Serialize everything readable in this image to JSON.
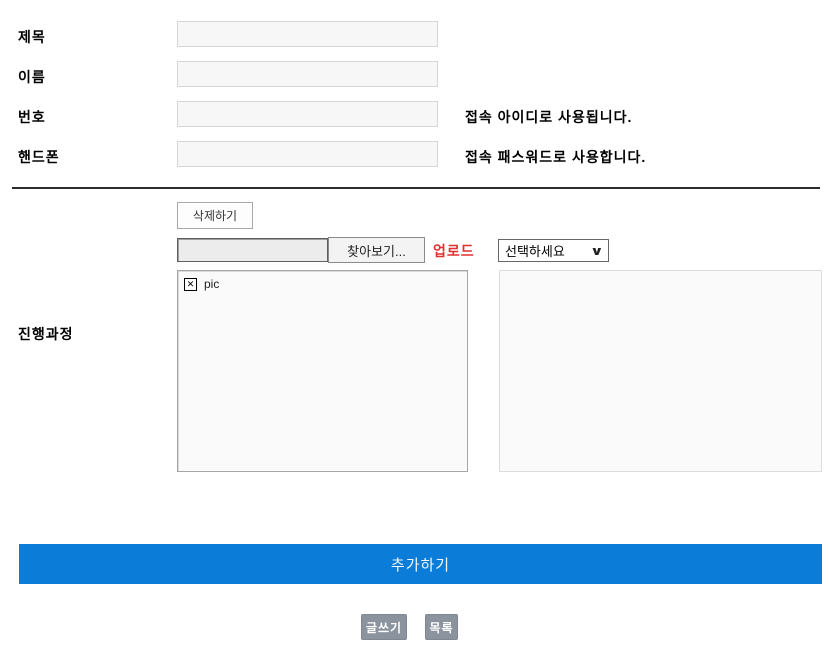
{
  "form": {
    "rows": [
      {
        "label": "제목",
        "note": ""
      },
      {
        "label": "이름",
        "note": ""
      },
      {
        "label": "번호",
        "note": "접속 아이디로 사용됩니다."
      },
      {
        "label": "핸드폰",
        "note": "접속 패스워드로 사용합니다."
      }
    ],
    "inputs": [
      {
        "value": "",
        "placeholder": ""
      },
      {
        "value": "",
        "placeholder": ""
      },
      {
        "value": "",
        "placeholder": ""
      },
      {
        "value": "",
        "placeholder": ""
      }
    ],
    "progress_label": "진행과정"
  },
  "upload": {
    "delete_button": "삭제하기",
    "file_input_value": "",
    "browse_button": "찾아보기...",
    "upload_link": "업로드",
    "select_value": "선택하세요",
    "file_list": [
      {
        "name": "pic",
        "icon": "broken-image-icon"
      }
    ]
  },
  "actions": {
    "add_button": "추가하기",
    "write_button": "글쓰기",
    "list_button": "목록"
  },
  "icons": {
    "broken_image_glyph": "✕",
    "chevron_down_glyph": "∨"
  },
  "colors": {
    "accent_blue": "#0b7dd8",
    "button_gray": "#8a939e",
    "upload_red": "#e03131",
    "divider_dark": "#2b2b2b"
  }
}
